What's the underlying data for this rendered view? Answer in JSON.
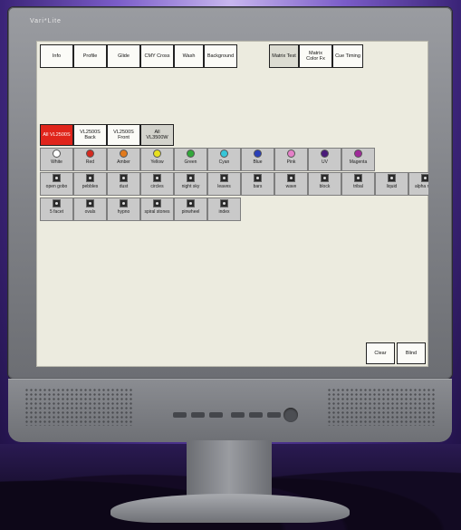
{
  "monitor": {
    "brand": "Vari*Lite"
  },
  "top_tabs": [
    {
      "label": "Info"
    },
    {
      "label": "Profile"
    },
    {
      "label": "Glide"
    },
    {
      "label": "CMY Cross"
    },
    {
      "label": "Wash"
    },
    {
      "label": "Background"
    }
  ],
  "right_tabs": [
    {
      "label": "Matrix Test"
    },
    {
      "label": "Matrix\nColor Fx"
    },
    {
      "label": "Cue Timing"
    }
  ],
  "fixture_tabs": [
    {
      "label": "All VL2500S"
    },
    {
      "label": "VL2500S\nBack"
    },
    {
      "label": "VL2500S\nFront"
    },
    {
      "label": "All\nVL3500W"
    }
  ],
  "colors": [
    {
      "label": "White",
      "icon": "white-swatch-icon",
      "hex": "#ffffff"
    },
    {
      "label": "Red",
      "icon": "red-swatch-icon",
      "hex": "#d42a1f"
    },
    {
      "label": "Amber",
      "icon": "amber-swatch-icon",
      "hex": "#e27a1c"
    },
    {
      "label": "Yellow",
      "icon": "yellow-swatch-icon",
      "hex": "#e8e01e"
    },
    {
      "label": "Green",
      "icon": "green-swatch-icon",
      "hex": "#32a83a"
    },
    {
      "label": "Cyan",
      "icon": "cyan-swatch-icon",
      "hex": "#36c6d8"
    },
    {
      "label": "Blue",
      "icon": "blue-swatch-icon",
      "hex": "#2a3fb8"
    },
    {
      "label": "Pink",
      "icon": "pink-swatch-icon",
      "hex": "#e57fc8"
    },
    {
      "label": "UV",
      "icon": "uv-swatch-icon",
      "hex": "#4a1a7a"
    },
    {
      "label": "Magenta",
      "icon": "magenta-swatch-icon",
      "hex": "#a02a9a"
    }
  ],
  "gobos_row1": [
    {
      "label": "open gobo"
    },
    {
      "label": "pebbles"
    },
    {
      "label": "dust"
    },
    {
      "label": "circles"
    },
    {
      "label": "night sky"
    },
    {
      "label": "leaves"
    },
    {
      "label": "bars"
    },
    {
      "label": "wave"
    },
    {
      "label": "block"
    },
    {
      "label": "tribal"
    },
    {
      "label": "liquid"
    },
    {
      "label": "alpha rays"
    }
  ],
  "gobos_row2": [
    {
      "label": "5 facet"
    },
    {
      "label": "ovals"
    },
    {
      "label": "hypno"
    },
    {
      "label": "spiral stones"
    },
    {
      "label": "pinwheel"
    },
    {
      "label": "index"
    }
  ],
  "footer": {
    "clear_label": "Clear",
    "blind_label": "Blind"
  },
  "theme": {
    "selected_tab": "#e0251b",
    "screen_bg": "#ecebdf"
  }
}
